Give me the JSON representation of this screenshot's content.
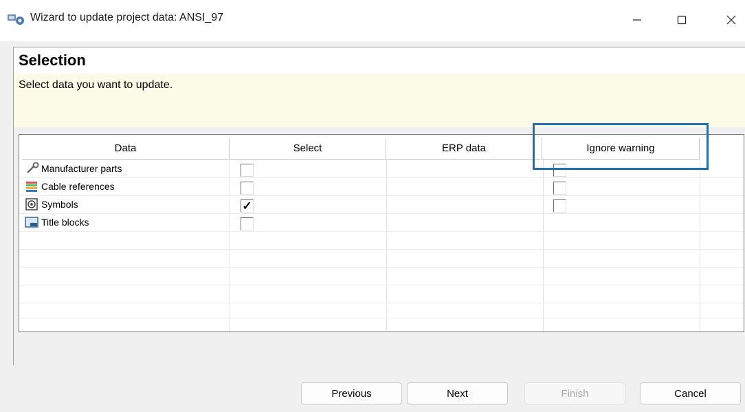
{
  "window": {
    "title": "Wizard to update project data: ANSI_97",
    "icon": "wizard-app-icon",
    "controls": {
      "minimize": "—",
      "maximize": "☐",
      "close": "✕"
    }
  },
  "header": {
    "title": "Selection",
    "description": "Select data you want to update."
  },
  "grid": {
    "columns": [
      "Data",
      "Select",
      "ERP data",
      "Ignore warning"
    ],
    "rows": [
      {
        "label": "Manufacturer parts",
        "icon": "wrench-icon",
        "select": false,
        "ignore_warning": false
      },
      {
        "label": "Cable references",
        "icon": "cable-icon",
        "select": false,
        "ignore_warning": false
      },
      {
        "label": "Symbols",
        "icon": "symbol-icon",
        "select": true,
        "select_mark": "✓",
        "ignore_warning": false
      },
      {
        "label": "Title blocks",
        "icon": "title-block-icon",
        "select": false
      }
    ]
  },
  "buttons": {
    "previous": "Previous",
    "next": "Next",
    "finish": "Finish",
    "cancel": "Cancel"
  },
  "colors": {
    "header_bg": "#fbfbe7",
    "highlight": "#1f6fa8"
  }
}
